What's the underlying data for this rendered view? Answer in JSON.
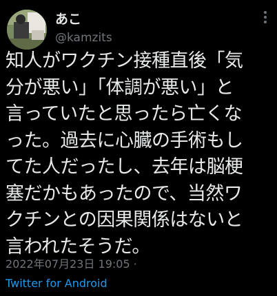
{
  "tweet": {
    "author": {
      "display_name": "あこ",
      "handle": "@kamzits"
    },
    "text_lines": [
      "知人がワクチン接種直後「気",
      "分が悪い」「体調が悪い」と",
      "言っていたと思ったら亡くな",
      "った。過去に心臓の手術もし",
      "てた人だったし、去年は脳梗",
      "塞だかもあったので、当然ワ",
      "クチンとの因果関係はないと",
      "言われたそうだ。"
    ],
    "timestamp": "2022年07月23日 19:05",
    "separator": "·",
    "source": "Twitter for Android"
  },
  "icons": {
    "more": "more-vertical-icon",
    "avatar": "profile-photo"
  },
  "colors": {
    "background": "#000000",
    "text": "#e7e9ea",
    "secondary": "#71767b",
    "link": "#1d9bf0"
  }
}
